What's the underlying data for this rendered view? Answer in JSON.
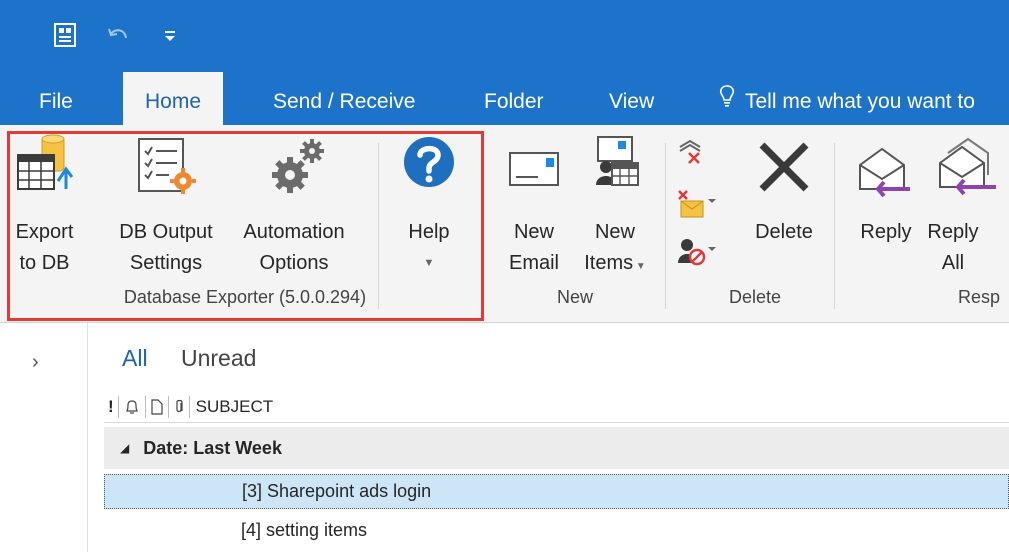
{
  "tabs": [
    {
      "label": "File"
    },
    {
      "label": "Home"
    },
    {
      "label": "Send / Receive"
    },
    {
      "label": "Folder"
    },
    {
      "label": "View"
    }
  ],
  "tell_me": "Tell me what you want to",
  "ribbon": {
    "export_db": {
      "line1": "Export",
      "line2": "to DB"
    },
    "db_output": {
      "line1": "DB Output",
      "line2": "Settings"
    },
    "automation": {
      "line1": "Automation",
      "line2": "Options"
    },
    "help": {
      "line1": "Help"
    },
    "new_email": {
      "line1": "New",
      "line2": "Email"
    },
    "new_items": {
      "line1": "New",
      "line2": "Items"
    },
    "delete": {
      "line1": "Delete"
    },
    "reply": {
      "line1": "Reply"
    },
    "reply_all": {
      "line1": "Reply",
      "line2": "All"
    },
    "groups": {
      "database_exporter": "Database Exporter (5.0.0.294)",
      "new": "New",
      "delete": "Delete",
      "respond": "Resp"
    }
  },
  "list": {
    "filter_all": "All",
    "filter_unread": "Unread",
    "column_subject": "SUBJECT",
    "group_header": "Date: Last Week",
    "rows": [
      {
        "subject": "[3] Sharepoint ads login"
      },
      {
        "subject": "[4] setting items"
      }
    ]
  },
  "colors": {
    "accent": "#1d73c9",
    "highlight": "#e53935",
    "selected_row": "#cde6f7"
  }
}
